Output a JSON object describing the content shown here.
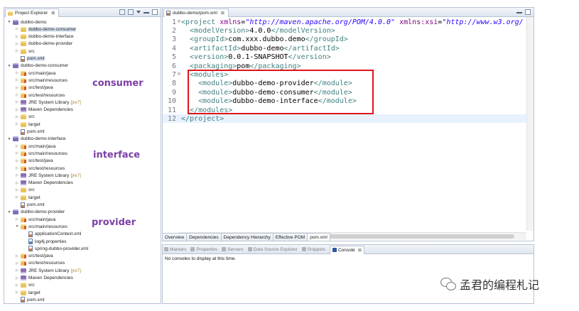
{
  "explorer": {
    "tab_title": "Project Explorer",
    "tab_close": "⊠",
    "tree": [
      {
        "label": "dubbo-demo",
        "depth": 0,
        "icon": "project",
        "expanded": true
      },
      {
        "label": "dubbo-demo-consumer",
        "depth": 1,
        "icon": "folder",
        "expanded": false,
        "selected": true
      },
      {
        "label": "dubbo-demo-interface",
        "depth": 1,
        "icon": "folder",
        "expanded": false
      },
      {
        "label": "dubbo-demo-provider",
        "depth": 1,
        "icon": "folder",
        "expanded": false
      },
      {
        "label": "src",
        "depth": 1,
        "icon": "folder",
        "expanded": false
      },
      {
        "label": "pom.xml",
        "depth": 1,
        "icon": "xml",
        "leaf": true,
        "selected": true
      },
      {
        "label": "dubbo-demo-consumer",
        "depth": 0,
        "icon": "project",
        "expanded": true
      },
      {
        "label": "src/main/java",
        "depth": 1,
        "icon": "srcfolder",
        "expanded": false
      },
      {
        "label": "src/main/resources",
        "depth": 1,
        "icon": "srcfolder",
        "expanded": false
      },
      {
        "label": "src/test/java",
        "depth": 1,
        "icon": "srcfolder",
        "expanded": false
      },
      {
        "label": "src/test/resources",
        "depth": 1,
        "icon": "srcfolder",
        "expanded": false
      },
      {
        "label": "JRE System Library",
        "decoration": "[jre7]",
        "depth": 1,
        "icon": "lib",
        "expanded": false
      },
      {
        "label": "Maven Dependencies",
        "depth": 1,
        "icon": "lib",
        "expanded": false
      },
      {
        "label": "src",
        "depth": 1,
        "icon": "folder",
        "expanded": false
      },
      {
        "label": "target",
        "depth": 1,
        "icon": "folder",
        "expanded": false
      },
      {
        "label": "pom.xml",
        "depth": 1,
        "icon": "xml",
        "leaf": true
      },
      {
        "label": "dubbo-demo-interface",
        "depth": 0,
        "icon": "project",
        "expanded": true
      },
      {
        "label": "src/main/java",
        "depth": 1,
        "icon": "srcfolder",
        "expanded": false
      },
      {
        "label": "src/main/resources",
        "depth": 1,
        "icon": "srcfolder",
        "expanded": false
      },
      {
        "label": "src/test/java",
        "depth": 1,
        "icon": "srcfolder",
        "expanded": false
      },
      {
        "label": "src/test/resources",
        "depth": 1,
        "icon": "srcfolder",
        "expanded": false
      },
      {
        "label": "JRE System Library",
        "decoration": "[jre7]",
        "depth": 1,
        "icon": "lib",
        "expanded": false
      },
      {
        "label": "Maven Dependencies",
        "depth": 1,
        "icon": "lib",
        "expanded": false
      },
      {
        "label": "src",
        "depth": 1,
        "icon": "folder",
        "expanded": false
      },
      {
        "label": "target",
        "depth": 1,
        "icon": "folder",
        "expanded": false
      },
      {
        "label": "pom.xml",
        "depth": 1,
        "icon": "xml",
        "leaf": true
      },
      {
        "label": "dubbo-demo-provider",
        "depth": 0,
        "icon": "project",
        "expanded": true
      },
      {
        "label": "src/main/java",
        "depth": 1,
        "icon": "srcfolder",
        "expanded": false
      },
      {
        "label": "src/main/resources",
        "depth": 1,
        "icon": "srcfolder",
        "expanded": true
      },
      {
        "label": "applicationContext.xml",
        "depth": 2,
        "icon": "xml",
        "leaf": true
      },
      {
        "label": "log4j.properties",
        "depth": 2,
        "icon": "props",
        "leaf": true
      },
      {
        "label": "spring-dubbo-provider.xml",
        "depth": 2,
        "icon": "xml",
        "leaf": true
      },
      {
        "label": "src/test/java",
        "depth": 1,
        "icon": "srcfolder",
        "expanded": false
      },
      {
        "label": "src/test/resources",
        "depth": 1,
        "icon": "srcfolder",
        "expanded": false
      },
      {
        "label": "JRE System Library",
        "decoration": "[jre7]",
        "depth": 1,
        "icon": "lib",
        "expanded": false
      },
      {
        "label": "Maven Dependencies",
        "depth": 1,
        "icon": "lib",
        "expanded": false
      },
      {
        "label": "src",
        "depth": 1,
        "icon": "folder",
        "expanded": false
      },
      {
        "label": "target",
        "depth": 1,
        "icon": "folder",
        "expanded": false
      },
      {
        "label": "pom.xml",
        "depth": 1,
        "icon": "xml",
        "leaf": true
      }
    ]
  },
  "annotations": {
    "consumer": "consumer",
    "interface": "interface",
    "provider": "provider"
  },
  "editor": {
    "tab_title": "dubbo-demo/pom.xml",
    "tab_close": "⊠",
    "lines": [
      {
        "n": "1",
        "fold": "⊖",
        "parts": [
          [
            "tag",
            "<project "
          ],
          [
            "attr",
            "xmlns"
          ],
          [
            "txt",
            "="
          ],
          [
            "val",
            "\"http://maven.apache.org/POM/4.0.0\""
          ],
          [
            "txt",
            " "
          ],
          [
            "attr",
            "xmlns:xsi"
          ],
          [
            "txt",
            "="
          ],
          [
            "val",
            "\"http://www.w3.org/"
          ]
        ]
      },
      {
        "n": "2",
        "parts": [
          [
            "txt",
            "  "
          ],
          [
            "tag",
            "<modelVersion>"
          ],
          [
            "txt",
            "4.0.0"
          ],
          [
            "tag",
            "</modelVersion>"
          ]
        ]
      },
      {
        "n": "3",
        "parts": [
          [
            "txt",
            "  "
          ],
          [
            "tag",
            "<groupId>"
          ],
          [
            "txt",
            "com.xxx.dubbo.demo"
          ],
          [
            "tag",
            "</groupId>"
          ]
        ]
      },
      {
        "n": "4",
        "parts": [
          [
            "txt",
            "  "
          ],
          [
            "tag",
            "<artifactId>"
          ],
          [
            "txt",
            "dubbo-demo"
          ],
          [
            "tag",
            "</artifactId>"
          ]
        ]
      },
      {
        "n": "5",
        "parts": [
          [
            "txt",
            "  "
          ],
          [
            "tag",
            "<version>"
          ],
          [
            "txt",
            "0.0.1-SNAPSHOT"
          ],
          [
            "tag",
            "</version>"
          ]
        ]
      },
      {
        "n": "6",
        "parts": [
          [
            "txt",
            "  "
          ],
          [
            "tag",
            "<packaging>"
          ],
          [
            "txt",
            "pom"
          ],
          [
            "tag",
            "</packaging>"
          ]
        ]
      },
      {
        "n": "7",
        "fold": "⊖",
        "parts": [
          [
            "txt",
            "  "
          ],
          [
            "tag",
            "<modules>"
          ]
        ]
      },
      {
        "n": "8",
        "parts": [
          [
            "txt",
            "    "
          ],
          [
            "tag",
            "<module>"
          ],
          [
            "txt",
            "dubbo-demo-provider"
          ],
          [
            "tag",
            "</module>"
          ]
        ]
      },
      {
        "n": "9",
        "parts": [
          [
            "txt",
            "    "
          ],
          [
            "tag",
            "<module>"
          ],
          [
            "txt",
            "dubbo-demo-consumer"
          ],
          [
            "tag",
            "</module>"
          ]
        ]
      },
      {
        "n": "10",
        "parts": [
          [
            "txt",
            "    "
          ],
          [
            "tag",
            "<module>"
          ],
          [
            "txt",
            "dubbo-demo-interface"
          ],
          [
            "tag",
            "</module>"
          ]
        ]
      },
      {
        "n": "11",
        "parts": [
          [
            "txt",
            "  "
          ],
          [
            "tag",
            "</modules>"
          ]
        ]
      },
      {
        "n": "12",
        "current": true,
        "parts": [
          [
            "tag",
            "</project>"
          ]
        ]
      }
    ]
  },
  "pom_tabs": [
    "Overview",
    "Dependencies",
    "Dependency Hierarchy",
    "Effective POM",
    "pom.xml"
  ],
  "pom_tab_active": "pom.xml",
  "console": {
    "tabs": [
      "Markers",
      "Properties",
      "Servers",
      "Data Source Explorer",
      "Snippets",
      "Console"
    ],
    "active_tab": "Console",
    "message": "No consoles to display at this time."
  },
  "watermark": {
    "text": "孟君的编程札记"
  }
}
